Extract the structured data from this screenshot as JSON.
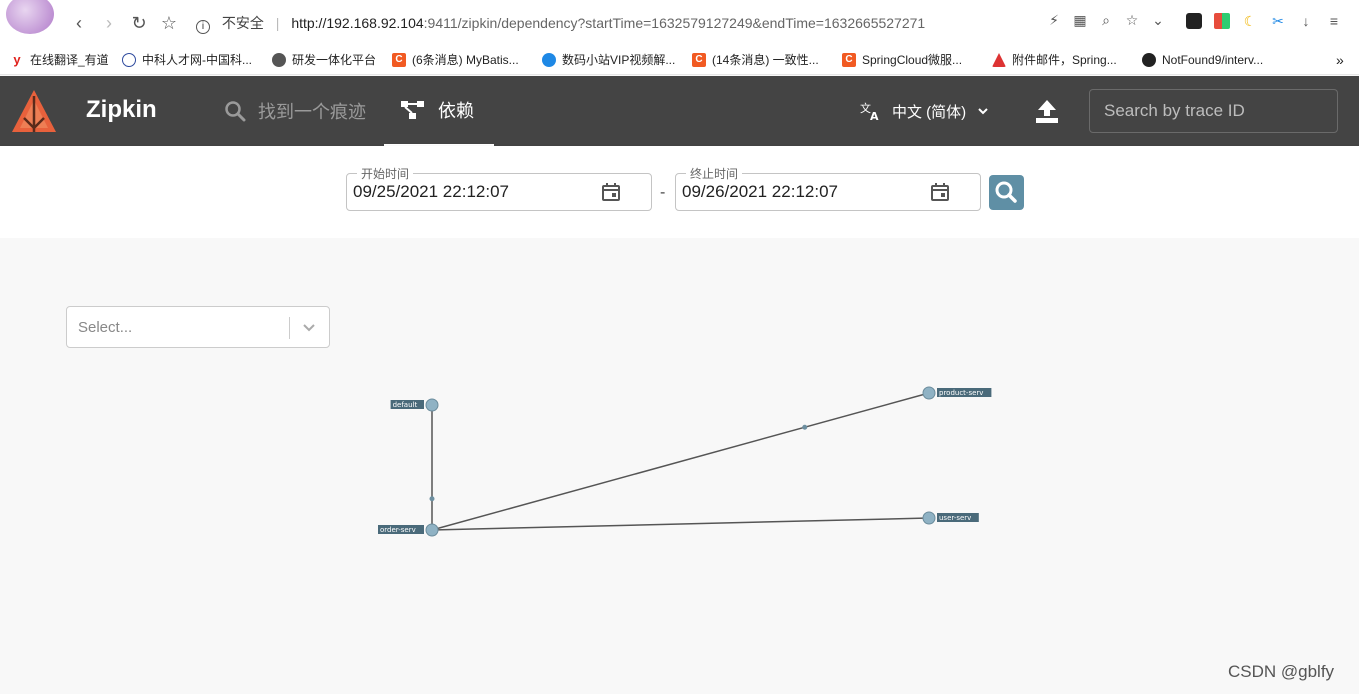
{
  "browser": {
    "security_label": "不安全",
    "url_host": "http://192.168.92.104",
    "url_path": ":9411/zipkin/dependency?startTime=1632579127249&endTime=1632665527271"
  },
  "bookmarks": [
    {
      "label": "在线翻译_有道",
      "icon": "youdao-icon",
      "color": "#e0221d"
    },
    {
      "label": "中科人才网-中国科...",
      "icon": "globe-icon",
      "color": "#2e4a9e"
    },
    {
      "label": "研发一体化平台",
      "icon": "globe-icon",
      "color": "#444444"
    },
    {
      "label": "(6条消息) MyBatis...",
      "icon": "csdn-icon",
      "color": "#f15a22"
    },
    {
      "label": "数码小站VIP视频解...",
      "icon": "globe-icon",
      "color": "#1e88e5"
    },
    {
      "label": "(14条消息) 一致性...",
      "icon": "csdn-icon",
      "color": "#f15a22"
    },
    {
      "label": "SpringCloud微服...",
      "icon": "csdn-icon",
      "color": "#f15a22"
    },
    {
      "label": "附件邮件，Spring...",
      "icon": "mail-icon",
      "color": "#d33"
    },
    {
      "label": "NotFound9/interv...",
      "icon": "github-icon",
      "color": "#222222"
    }
  ],
  "header": {
    "brand": "Zipkin",
    "nav_find": "找到一个痕迹",
    "nav_dependencies": "依赖",
    "language": "中文 (简体)",
    "search_placeholder": "Search by trace ID"
  },
  "filters": {
    "start_label": "开始时间",
    "start_value": "09/25/2021 22:12:07",
    "separator": "-",
    "end_label": "终止时间",
    "end_value": "09/26/2021 22:12:07"
  },
  "service_select": {
    "placeholder": "Select..."
  },
  "dependency_graph": {
    "nodes": [
      {
        "id": "default",
        "label": "default"
      },
      {
        "id": "product-serv",
        "label": "product-serv"
      },
      {
        "id": "order-serv",
        "label": "order-serv"
      },
      {
        "id": "user-serv",
        "label": "user-serv"
      }
    ],
    "edges": [
      {
        "from": "default",
        "to": "order-serv"
      },
      {
        "from": "order-serv",
        "to": "product-serv"
      },
      {
        "from": "order-serv",
        "to": "user-serv"
      }
    ]
  },
  "watermark": "CSDN @gblfy",
  "colors": {
    "header_bg": "#444444",
    "accent": "#5f8fa5",
    "node_fill": "#8fb2c4",
    "label_bg": "#4a6a7a"
  }
}
